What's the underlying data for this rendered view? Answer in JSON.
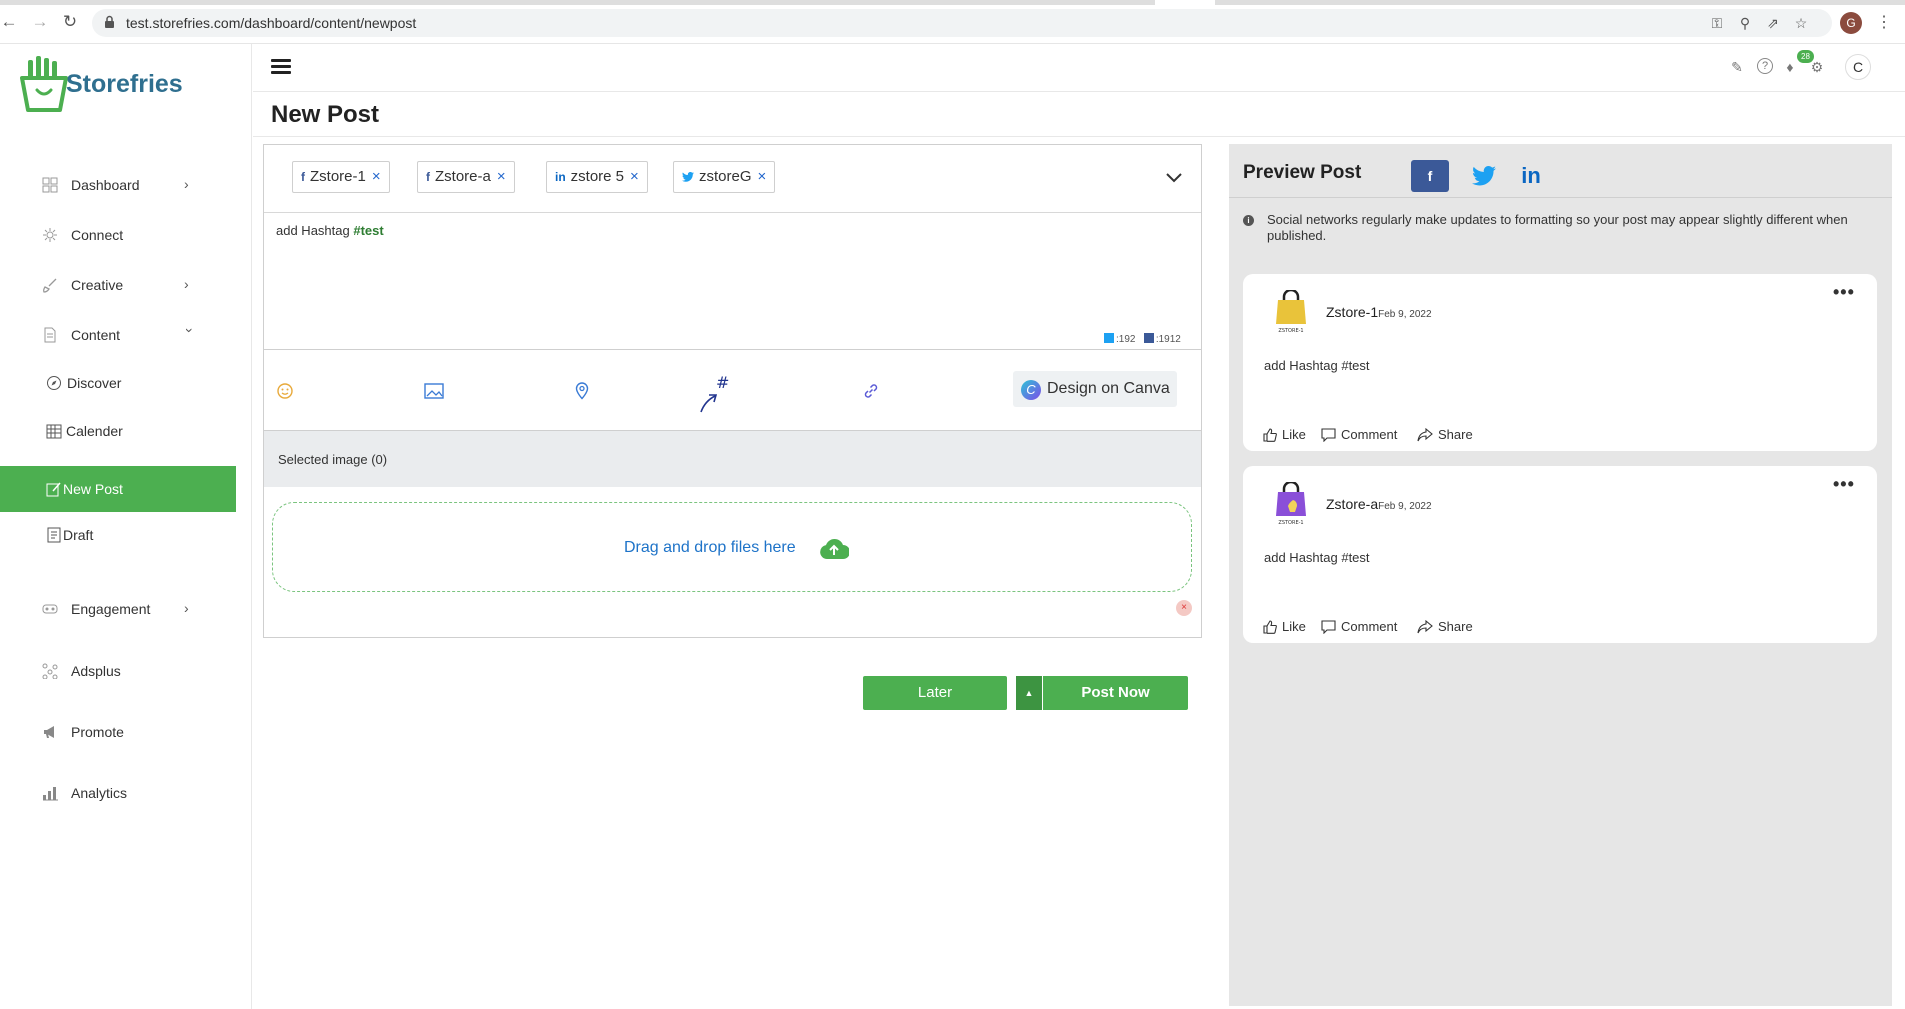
{
  "browser": {
    "url": "test.storefries.com/dashboard/content/newpost",
    "profile_initial": "G"
  },
  "brand": {
    "name": "Storefries"
  },
  "sidebar": {
    "items": [
      {
        "label": "Dashboard",
        "icon": "grid-icon",
        "has_chevron": true
      },
      {
        "label": "Connect",
        "icon": "connect-icon",
        "has_chevron": false
      },
      {
        "label": "Creative",
        "icon": "brush-icon",
        "has_chevron": true
      },
      {
        "label": "Content",
        "icon": "document-icon",
        "has_chevron": true,
        "expanded": true
      },
      {
        "label": "Engagement",
        "icon": "engagement-icon",
        "has_chevron": true
      },
      {
        "label": "Adsplus",
        "icon": "nodes-icon",
        "has_chevron": false
      },
      {
        "label": "Promote",
        "icon": "megaphone-icon",
        "has_chevron": false
      },
      {
        "label": "Analytics",
        "icon": "bar-chart-icon",
        "has_chevron": false
      }
    ],
    "content_sub": [
      {
        "label": "Discover",
        "icon": "compass-icon"
      },
      {
        "label": "Calender",
        "icon": "calendar-icon"
      },
      {
        "label": "New Post",
        "icon": "edit-icon",
        "active": true
      },
      {
        "label": "Draft",
        "icon": "draft-icon"
      }
    ]
  },
  "topbar": {
    "notification_count": "28",
    "user_initial": "C"
  },
  "page": {
    "title": "New Post"
  },
  "composer": {
    "accounts": [
      {
        "network": "facebook",
        "net_glyph": "f",
        "name": "Zstore-1"
      },
      {
        "network": "facebook",
        "net_glyph": "f",
        "name": "Zstore-a"
      },
      {
        "network": "linkedin",
        "net_glyph": "in",
        "name": "zstore 5"
      },
      {
        "network": "twitter",
        "net_glyph": "t",
        "name": "zstoreG"
      }
    ],
    "text_prefix": "add Hashtag ",
    "text_tag": "#test",
    "counters": {
      "twitter": ":192",
      "facebook": ":1912"
    },
    "canva_label": "Design on Canva",
    "selected_images": "Selected image (0)",
    "dropzone_label": "Drag and drop files here"
  },
  "actions": {
    "later": "Later",
    "post_now": "Post Now"
  },
  "preview": {
    "title": "Preview Post",
    "fb_glyph": "f",
    "li_glyph": "in",
    "info": "Social networks regularly make updates to formatting so your post may appear slightly different when published.",
    "posts": [
      {
        "account": "Zstore-1",
        "date": "Feb 9, 2022",
        "text": "add Hashtag #test",
        "logo_caption": "ZSTORE-1",
        "bag_color": "#e9c33a"
      },
      {
        "account": "Zstore-a",
        "date": "Feb 9, 2022",
        "text": "add Hashtag #test",
        "logo_caption": "ZSTORE-1",
        "bag_color": "#8a4fd8"
      }
    ],
    "actions": {
      "like": "Like",
      "comment": "Comment",
      "share": "Share"
    }
  },
  "colors": {
    "accent_green": "#4caf50",
    "brand_blue": "#2f6f8f",
    "facebook": "#3b5998",
    "twitter": "#1da1f2",
    "linkedin": "#0a66c2"
  }
}
